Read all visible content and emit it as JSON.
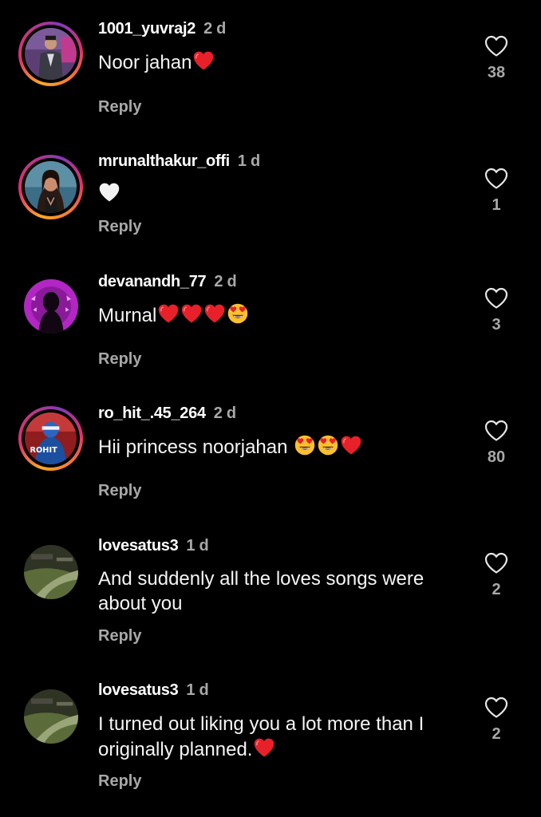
{
  "comments": [
    {
      "username": "1001_yuvraj2",
      "time": "2 d",
      "text": "Noor jahan",
      "emojis": [
        "red-heart"
      ],
      "likes": "38",
      "reply": "Reply",
      "avatar": "avatar-1"
    },
    {
      "username": "mrunalthakur_offi",
      "time": "1 d",
      "text": "",
      "emojis": [
        "white-heart"
      ],
      "likes": "1",
      "reply": "Reply",
      "avatar": "avatar-2"
    },
    {
      "username": "devanandh_77",
      "time": "2 d",
      "text": "Murnal",
      "emojis": [
        "red-heart",
        "red-heart",
        "red-heart",
        "heart-eyes"
      ],
      "likes": "3",
      "reply": "Reply",
      "avatar": "avatar-3"
    },
    {
      "username": "ro_hit_.45_264",
      "time": "2 d",
      "text": "Hii princess noorjahan ",
      "emojis": [
        "heart-eyes",
        "heart-eyes",
        "red-heart"
      ],
      "likes": "80",
      "reply": "Reply",
      "avatar": "avatar-4",
      "avatar_text": "ROHIT"
    },
    {
      "username": "lovesatus3",
      "time": "1 d",
      "text": "And suddenly all the loves songs were about you",
      "emojis": [],
      "likes": "2",
      "reply": "Reply",
      "avatar": "avatar-5"
    },
    {
      "username": "lovesatus3",
      "time": "1 d",
      "text": "I turned out liking you a lot more than I originally planned.",
      "emojis": [
        "red-heart"
      ],
      "likes": "2",
      "reply": "Reply",
      "avatar": "avatar-6"
    }
  ],
  "icons": {
    "like": "heart-outline-icon"
  },
  "colors": {
    "background": "#000000",
    "secondary_text": "#a8a8a8",
    "heart_red": "#e8202a"
  }
}
